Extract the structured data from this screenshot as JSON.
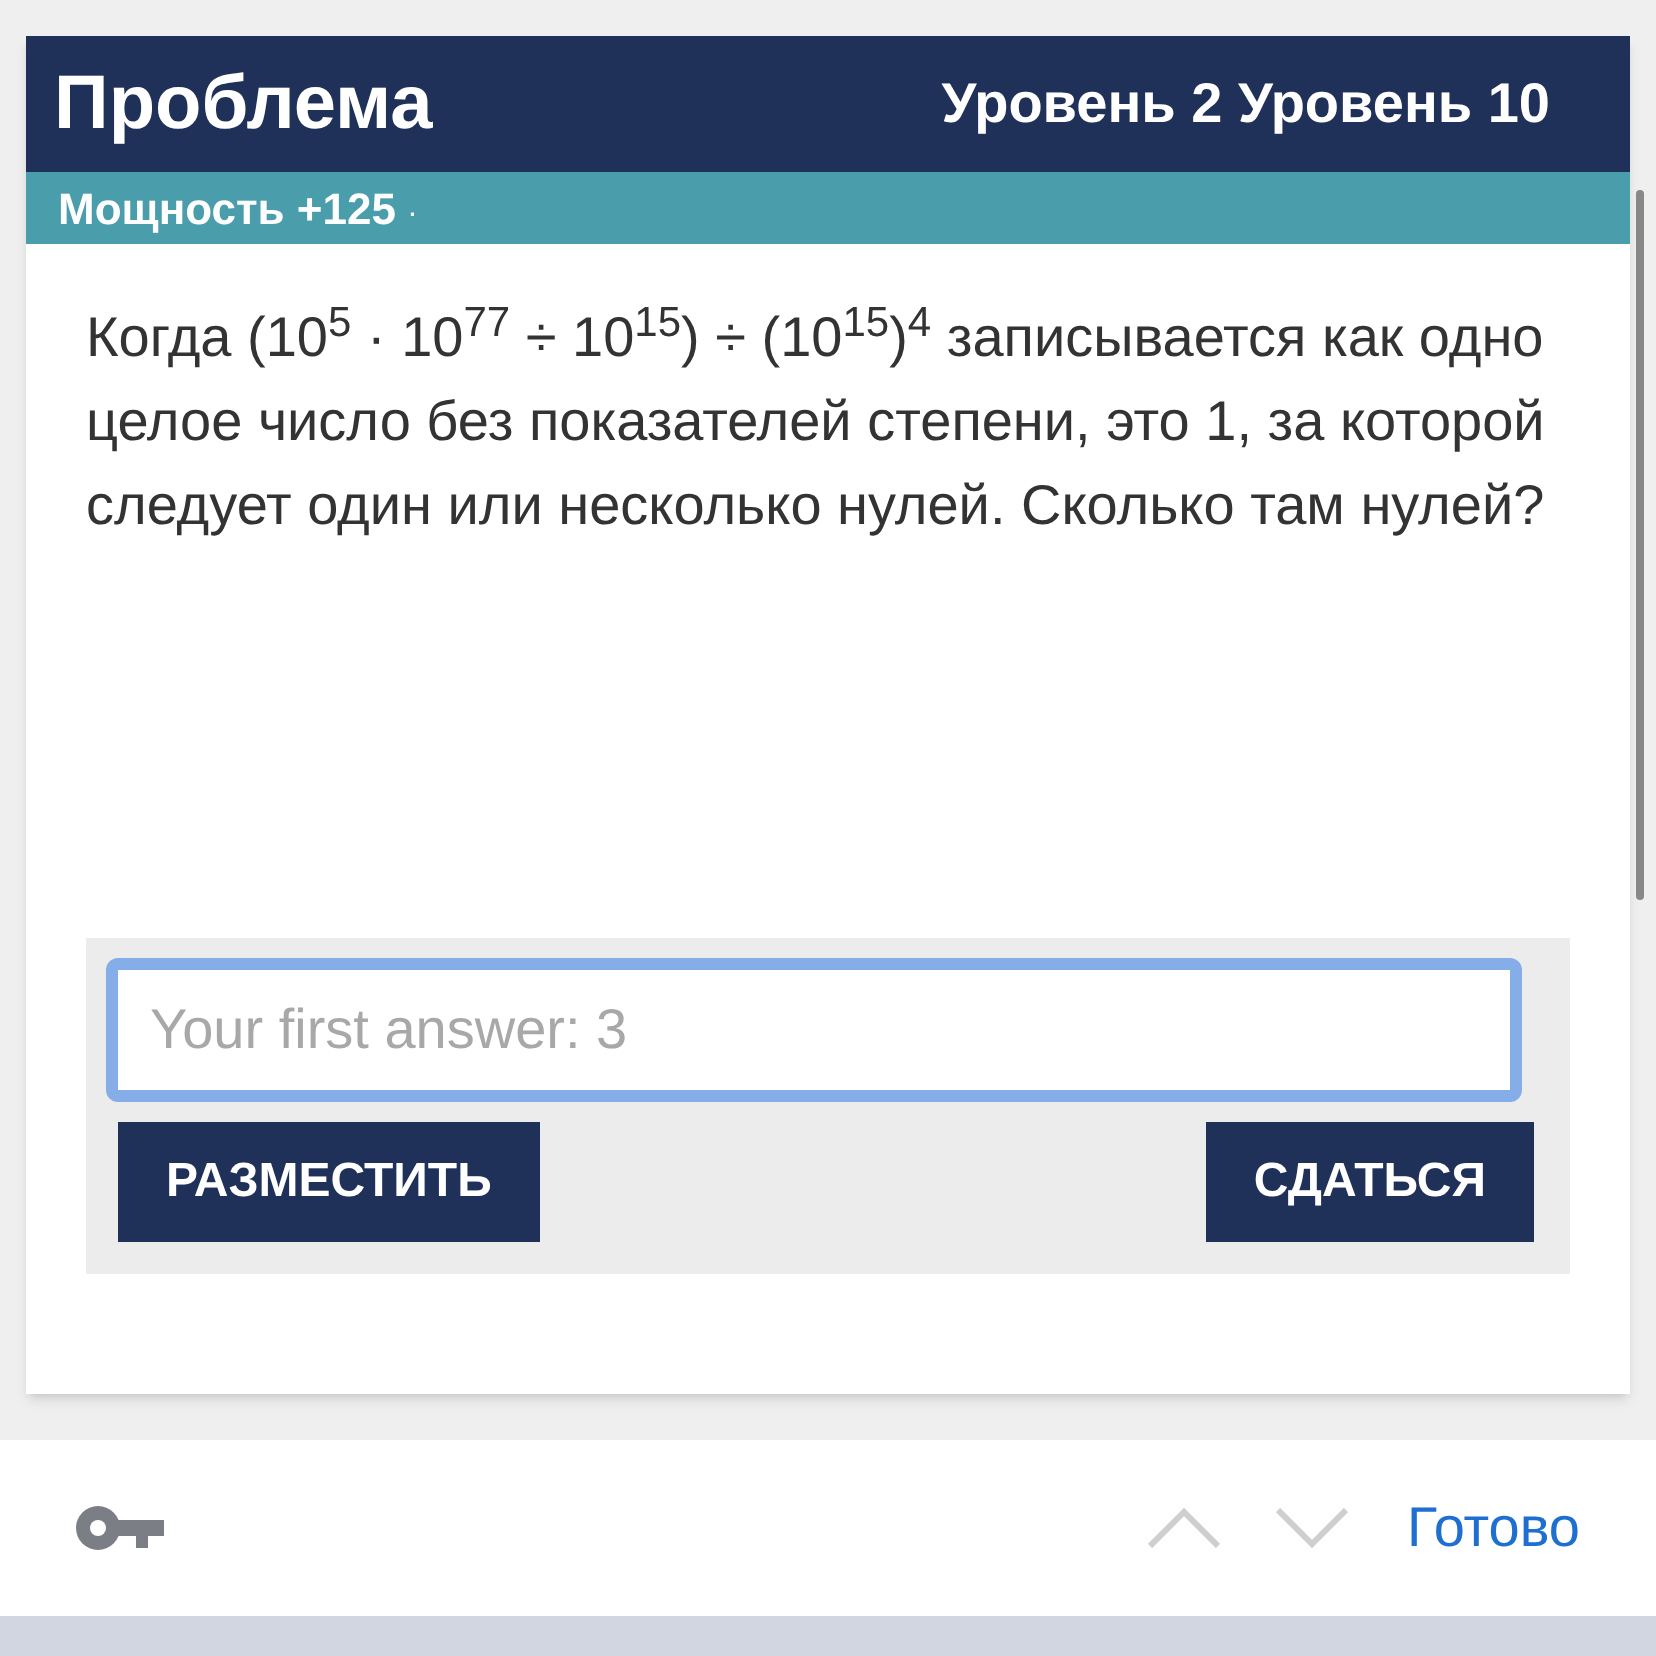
{
  "header": {
    "title": "Проблема",
    "levels": "Уровень 2 Уровень 10"
  },
  "power": {
    "label": "Мощность +125",
    "mark": "."
  },
  "question": "Когда (10$^{5}$ · 10$^{77}$ ÷ 10$^{15}$) ÷ (10$^{15}$)$^{4}$ записывается как одно целое число без показателей степени, это 1, за которой следует один или несколько нулей. Сколько там нулей?",
  "answer": {
    "placeholder": "Your first answer: 3",
    "focused": true
  },
  "buttons": [
    {
      "label": "РАЗМЕСТИТЬ"
    },
    {
      "label": "СДАТЬСЯ"
    }
  ],
  "keyboard_bar": {
    "done": "Готово"
  }
}
